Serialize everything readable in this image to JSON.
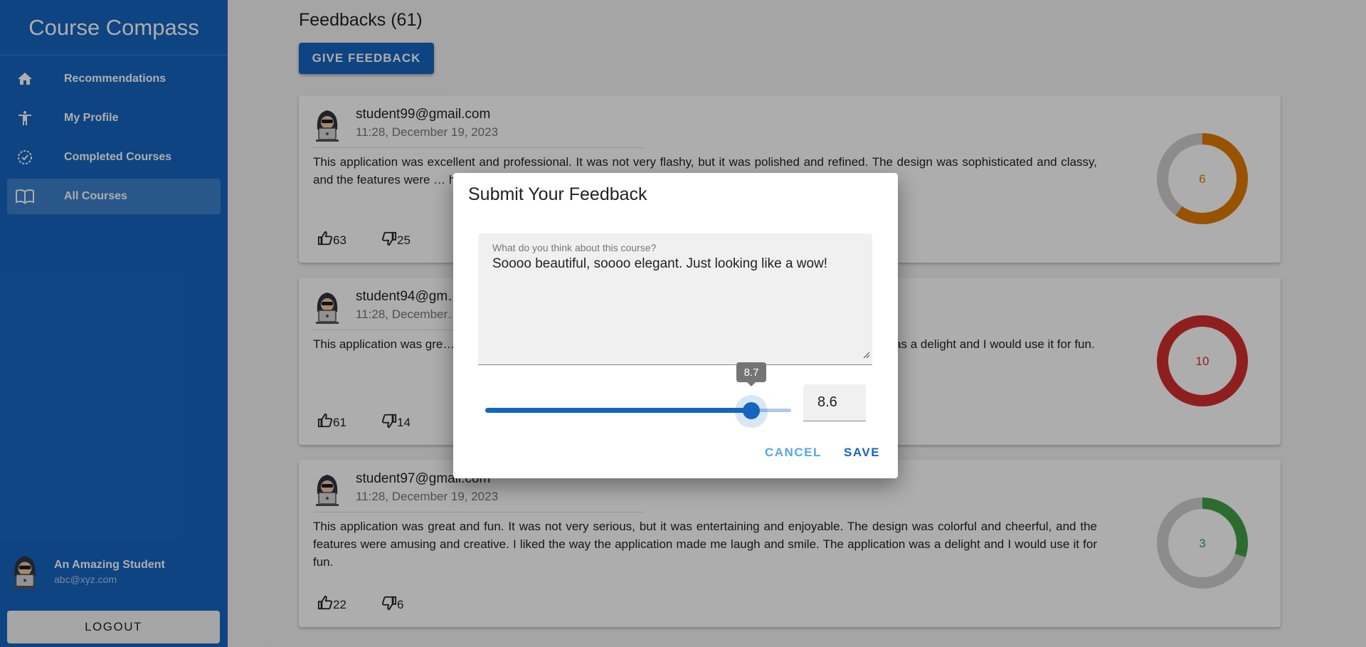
{
  "app": {
    "title": "Course Compass"
  },
  "sidebar": {
    "items": [
      {
        "label": "Recommendations",
        "icon": "home-icon"
      },
      {
        "label": "My Profile",
        "icon": "person-icon"
      },
      {
        "label": "Completed Courses",
        "icon": "check-circle-icon"
      },
      {
        "label": "All Courses",
        "icon": "book-icon",
        "active": true
      }
    ],
    "user": {
      "name": "An Amazing Student",
      "email": "abc@xyz.com"
    },
    "logout_label": "LOGOUT"
  },
  "main": {
    "title": "Feedbacks (61)",
    "give_feedback_label": "GIVE FEEDBACK",
    "feedbacks": [
      {
        "email": "student99@gmail.com",
        "date": "11:28, December 19, 2023",
        "text": "This application was excellent and professional. It was not very flashy, but it was polished and refined. The design was sophisticated and classy, and the features were … high-quality results and performance. The application was outs…",
        "likes": "63",
        "dislikes": "25",
        "rating": "6",
        "rating_fraction": 0.6,
        "color": "#e07b00"
      },
      {
        "email": "student94@gm…",
        "date": "11:28, December…",
        "text": "This application was gre… e design was colorful and cheerful, and the features were am… The application was a delight and I would use it for fun.",
        "likes": "61",
        "dislikes": "14",
        "rating": "10",
        "rating_fraction": 1.0,
        "color": "#d32f2f"
      },
      {
        "email": "student97@gmail.com",
        "date": "11:28, December 19, 2023",
        "text": "This application was great and fun. It was not very serious, but it was entertaining and enjoyable. The design was colorful and cheerful, and the features were amusing and creative. I liked the way the application made me laugh and smile. The application was a delight and I would use it for fun.",
        "likes": "22",
        "dislikes": "6",
        "rating": "3",
        "rating_fraction": 0.3,
        "color": "#43a047"
      }
    ]
  },
  "dialog": {
    "title": "Submit Your Feedback",
    "field_label": "What do you think about this course?",
    "field_value": "Soooo beautiful, soooo elegant. Just looking like a wow!",
    "slider_tooltip": "8.7",
    "slider_value": 8.7,
    "slider_max": 10,
    "number_value": "8.6",
    "cancel_label": "CANCEL",
    "save_label": "SAVE"
  },
  "colors": {
    "primary": "#1565c0",
    "secondary": "#55a8e6",
    "donut_track": "#cfcfcf"
  }
}
